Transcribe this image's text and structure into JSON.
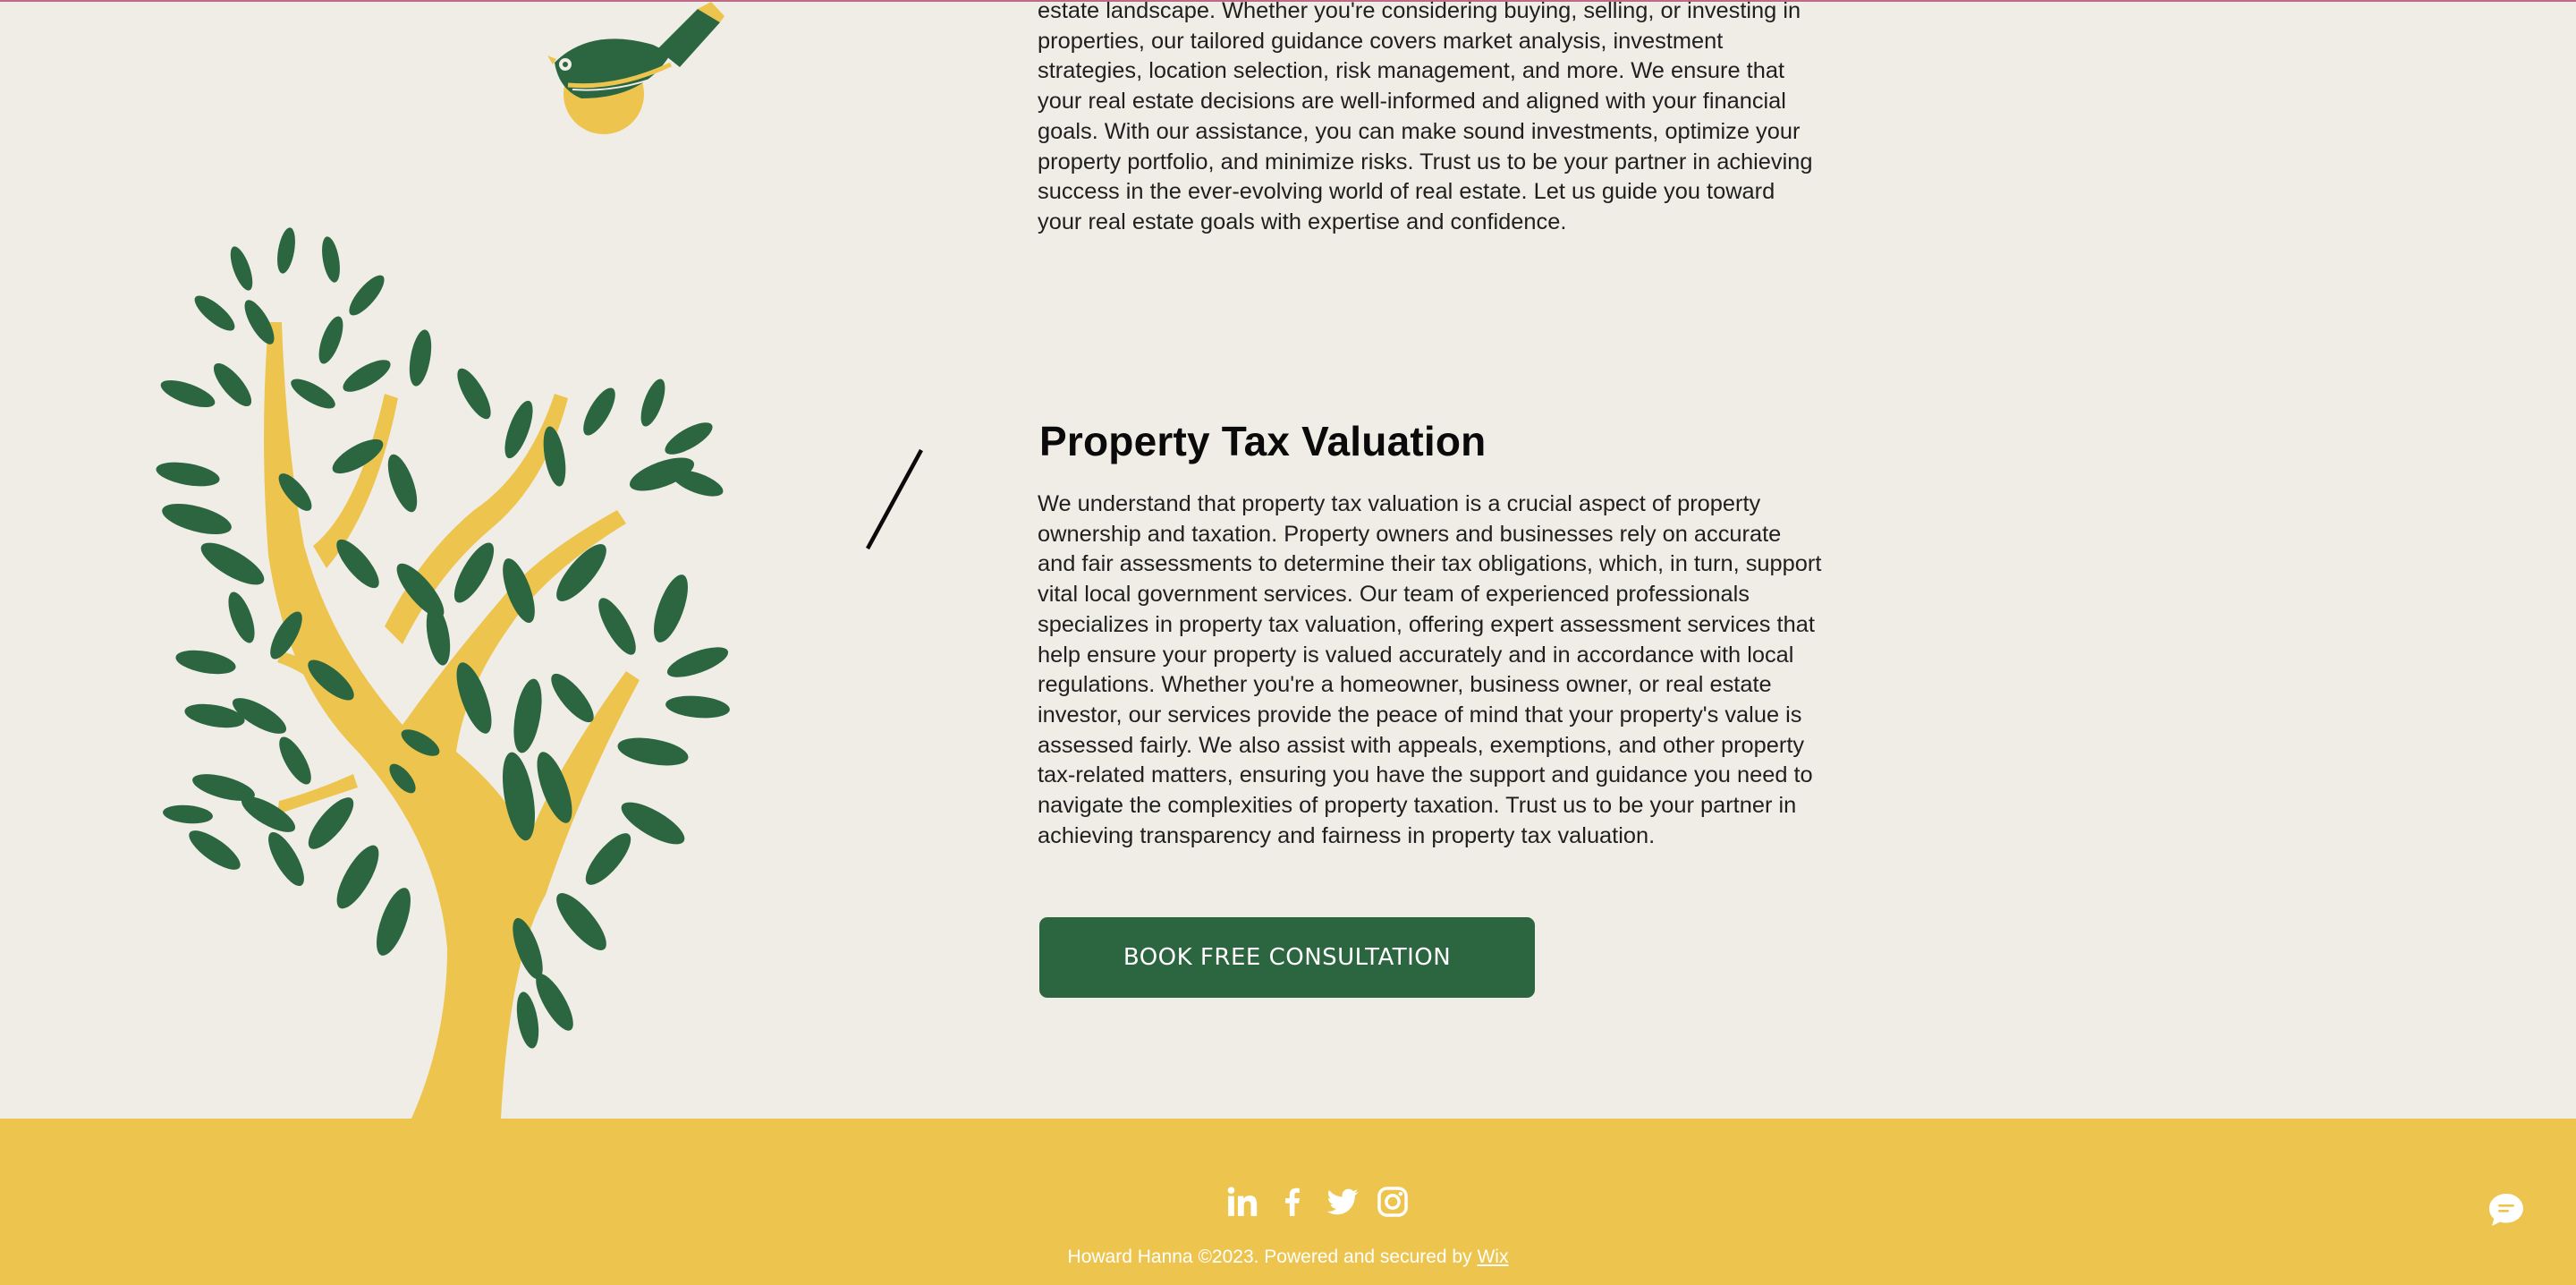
{
  "colors": {
    "background": "#F0EDE6",
    "accent_green": "#2C6641",
    "accent_yellow": "#EDC54E",
    "text": "#1f1f1f"
  },
  "intro": {
    "paragraph": "estate landscape. Whether you're considering buying, selling, or investing in properties, our tailored guidance covers market analysis, investment strategies, location selection, risk management, and more. We ensure that your real estate decisions are well-informed and aligned with your financial goals. With our assistance, you can make sound investments, optimize your property portfolio, and minimize risks. Trust us to be your partner in achieving success in the ever-evolving world of real estate. Let us guide you toward your real estate goals with expertise and confidence."
  },
  "tax_section": {
    "title": "Property Tax Valuation",
    "paragraph": "We understand that property tax valuation is a crucial aspect of property ownership and taxation. Property owners and businesses rely on accurate and fair assessments to determine their tax obligations, which, in turn, support vital local government services. Our team of experienced professionals specializes in property tax valuation, offering expert assessment services that help ensure your property is valued accurately and in accordance with local regulations. Whether you're a homeowner, business owner, or real estate investor, our services provide the peace of mind that your property's value is assessed fairly. We also assist with appeals, exemptions, and other property tax-related matters, ensuring you have the support and guidance you need to navigate the complexities of property taxation. Trust us to be your partner in achieving transparency and fairness in property tax valuation.",
    "cta_label": "BOOK FREE CONSULTATION"
  },
  "footer": {
    "social_icons": [
      "linkedin-icon",
      "facebook-icon",
      "twitter-icon",
      "instagram-icon"
    ],
    "copyright_text": "Howard Hanna ©2023. Powered and secured by ",
    "wix_link": "Wix"
  },
  "chat": {
    "icon": "chat-bubble-icon"
  }
}
